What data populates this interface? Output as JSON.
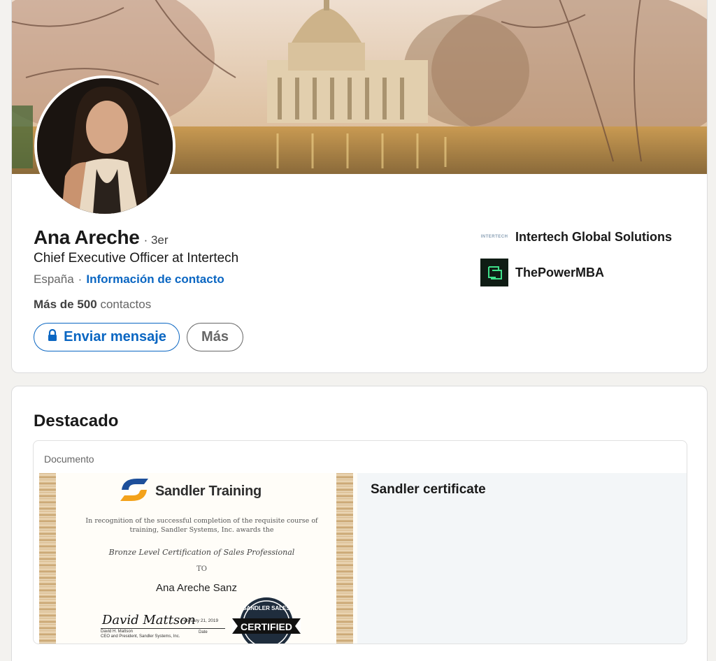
{
  "profile": {
    "name": "Ana Areche",
    "degree": "· 3er",
    "headline": "Chief Executive Officer at Intertech",
    "location": "España",
    "separator": "·",
    "contact_link": "Información de contacto",
    "connections_bold": "Más de 500",
    "connections_rest": "contactos"
  },
  "actions": {
    "message_label": "Enviar mensaje",
    "more_label": "Más"
  },
  "companies": [
    {
      "name": "Intertech Global Solutions",
      "logo_text": "INTERTECH"
    },
    {
      "name": "ThePowerMBA"
    }
  ],
  "featured": {
    "section_title": "Destacado",
    "item": {
      "type": "Documento",
      "title": "Sandler certificate",
      "thumbnail": {
        "brand": "Sandler Training",
        "text_1": "In recognition of the successful completion of the requisite course of training, Sandler Systems, Inc. awards the",
        "certification": "Bronze Level Certification of Sales Professional",
        "to": "TO",
        "recipient": "Ana Areche Sanz",
        "date": "February 21, 2019",
        "date_label": "Date",
        "signer_line1": "David H. Mattson",
        "signer_line2": "CEO and President, Sandler Systems, Inc.",
        "seal_top": "SANDLER SALES",
        "seal_main": "CERTIFIED"
      }
    }
  },
  "colors": {
    "link_blue": "#0a66c2",
    "page_bg": "#f3f2ef"
  }
}
